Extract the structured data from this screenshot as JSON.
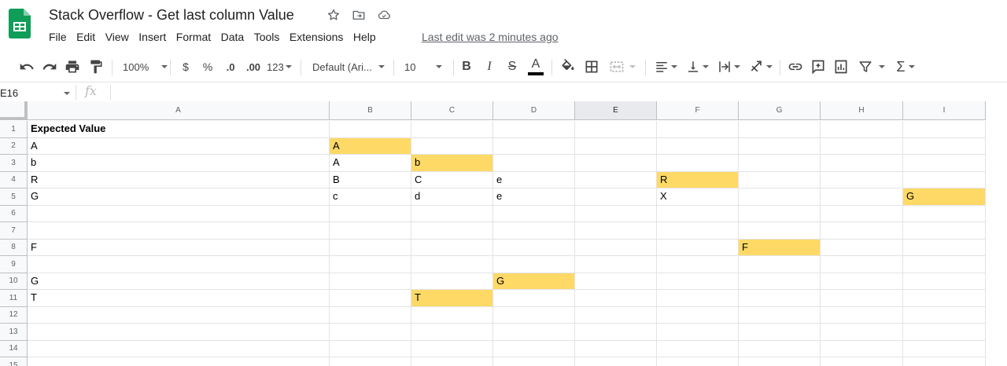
{
  "app": {
    "doc_title": "Stack Overflow - Get last column Value",
    "title_icons": [
      "star-icon",
      "move-to-folder-icon",
      "cloud-status-icon"
    ],
    "last_edit": "Last edit was 2 minutes ago",
    "brand_color": "#0f9d58"
  },
  "menu": [
    "File",
    "Edit",
    "View",
    "Insert",
    "Format",
    "Data",
    "Tools",
    "Extensions",
    "Help"
  ],
  "toolbar": {
    "zoom": "100%",
    "currency": "$",
    "percent": "%",
    "decrease_decimals": ".0",
    "increase_decimals": ".00",
    "more_formats": "123",
    "font": "Default (Ari...",
    "font_size": "10",
    "bold": "B",
    "italic": "I",
    "strikethrough": "S",
    "text_color": "A",
    "sum": "Σ"
  },
  "formula_bar": {
    "name_box": "E16",
    "fx": "fx",
    "value": ""
  },
  "grid": {
    "columns": [
      "A",
      "B",
      "C",
      "D",
      "E",
      "F",
      "G",
      "H",
      "I"
    ],
    "selected_column": "E",
    "rows": [
      "1",
      "2",
      "3",
      "4",
      "5",
      "6",
      "7",
      "8",
      "9",
      "10",
      "11",
      "12",
      "13",
      "14",
      "15"
    ],
    "highlight_color": "#ffd966",
    "cells": {
      "A1": "Expected Value",
      "A2": "A",
      "B2": "A",
      "A3": "b",
      "B3": "A",
      "C3": "b",
      "A4": "R",
      "B4": "B",
      "C4": "C",
      "D4": "e",
      "F4": "R",
      "A5": "G",
      "B5": "c",
      "C5": "d",
      "D5": "e",
      "F5": "X",
      "I5": "G",
      "A8": "F",
      "G8": "F",
      "A10": "G",
      "D10": "G",
      "A11": "T",
      "C11": "T"
    },
    "highlighted": [
      "B2",
      "C3",
      "F4",
      "I5",
      "G8",
      "D10",
      "C11"
    ],
    "bold": [
      "A1"
    ]
  }
}
